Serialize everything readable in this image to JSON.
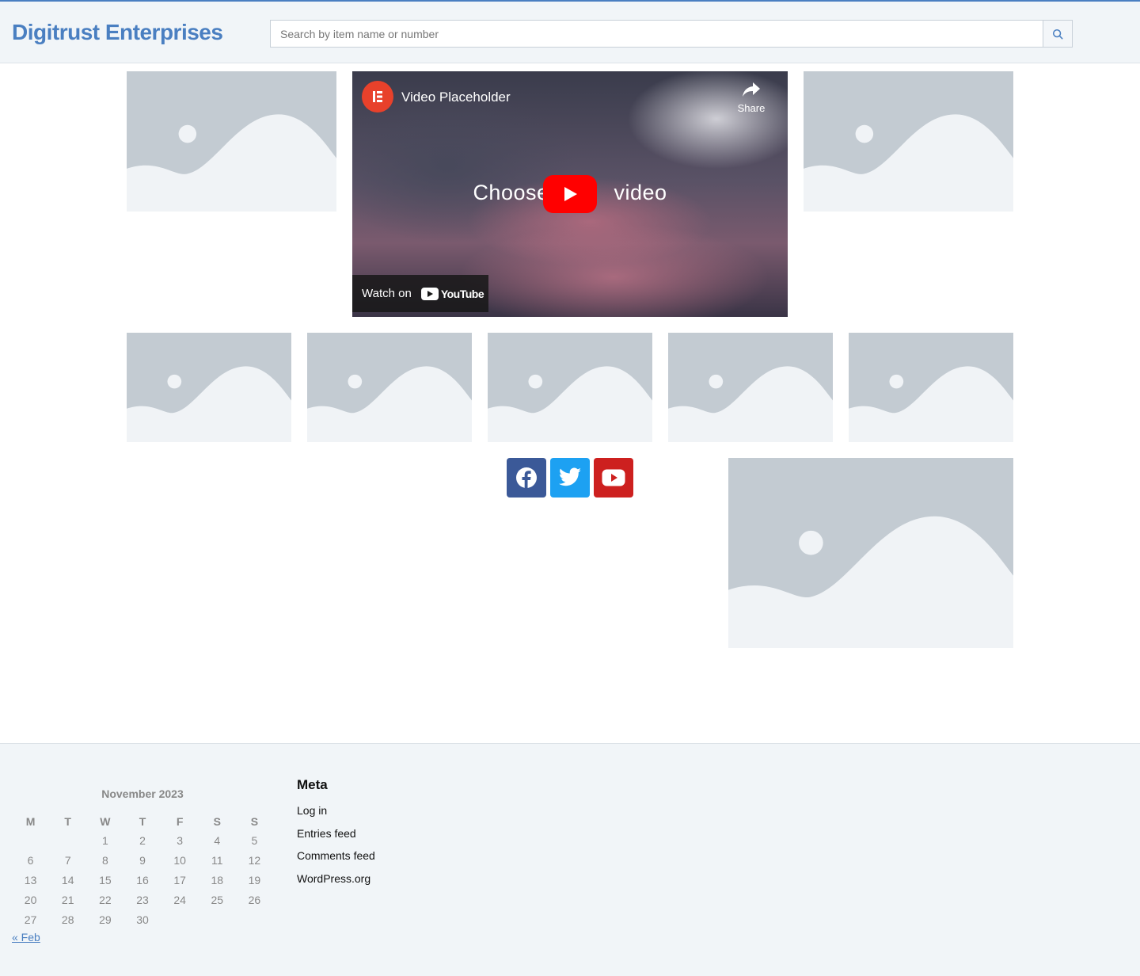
{
  "header": {
    "site_title": "Digitrust Enterprises",
    "search_placeholder": "Search by item name or number",
    "search_value": "",
    "accent_color": "#4a7fc1"
  },
  "video": {
    "title": "Video Placeholder",
    "share_label": "Share",
    "overlay_text": "Choose your video",
    "overlay_left": "Choose",
    "overlay_right": "video",
    "watch_on_label": "Watch on",
    "youtube_label": "YouTube",
    "channel_logo_icon": "elementor-logo-icon",
    "play_color": "#ff0000"
  },
  "images": {
    "placeholder_icon": "image-placeholder-icon"
  },
  "social": [
    {
      "name": "Facebook",
      "icon": "facebook-icon",
      "color": "#3b5998"
    },
    {
      "name": "Twitter",
      "icon": "twitter-icon",
      "color": "#1da1f2"
    },
    {
      "name": "YouTube",
      "icon": "youtube-icon",
      "color": "#cd201f"
    }
  ],
  "calendar": {
    "caption": "November 2023",
    "weekdays": [
      "M",
      "T",
      "W",
      "T",
      "F",
      "S",
      "S"
    ],
    "weeks": [
      [
        "",
        "",
        "1",
        "2",
        "3",
        "4",
        "5"
      ],
      [
        "6",
        "7",
        "8",
        "9",
        "10",
        "11",
        "12"
      ],
      [
        "13",
        "14",
        "15",
        "16",
        "17",
        "18",
        "19"
      ],
      [
        "20",
        "21",
        "22",
        "23",
        "24",
        "25",
        "26"
      ],
      [
        "27",
        "28",
        "29",
        "30",
        "",
        "",
        ""
      ]
    ],
    "prev_link": "« Feb"
  },
  "meta": {
    "heading": "Meta",
    "links": [
      "Log in",
      "Entries feed",
      "Comments feed",
      "WordPress.org"
    ]
  }
}
